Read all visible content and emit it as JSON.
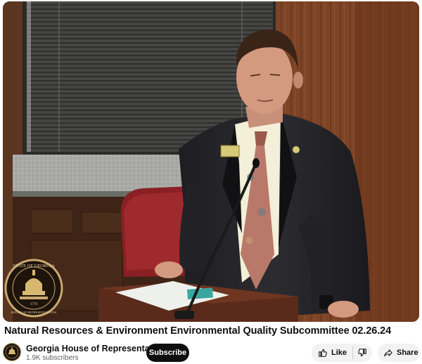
{
  "video": {
    "seal_top_text": "STATE OF GEORGIA",
    "seal_bottom_text": "HOUSE OF REPRESENTATIVES",
    "seal_year": "1776"
  },
  "title": "Natural Resources & Environment Environmental Quality Subcommittee 02.26.24",
  "channel": {
    "name": "Georgia House of Representatives",
    "subscribers": "1.9K subscribers",
    "avatar_icon": "georgia-house-seal-icon"
  },
  "actions": {
    "subscribe_label": "Subscribe",
    "like_label": "Like",
    "share_label": "Share",
    "like_icon": "thumbs-up-icon",
    "dislike_icon": "thumbs-down-icon",
    "share_icon": "share-arrow-icon"
  },
  "colors": {
    "subscribe_bg": "#0f0f0f",
    "pill_bg": "#f2f2f2",
    "text_primary": "#0f0f0f",
    "text_secondary": "#606060"
  }
}
